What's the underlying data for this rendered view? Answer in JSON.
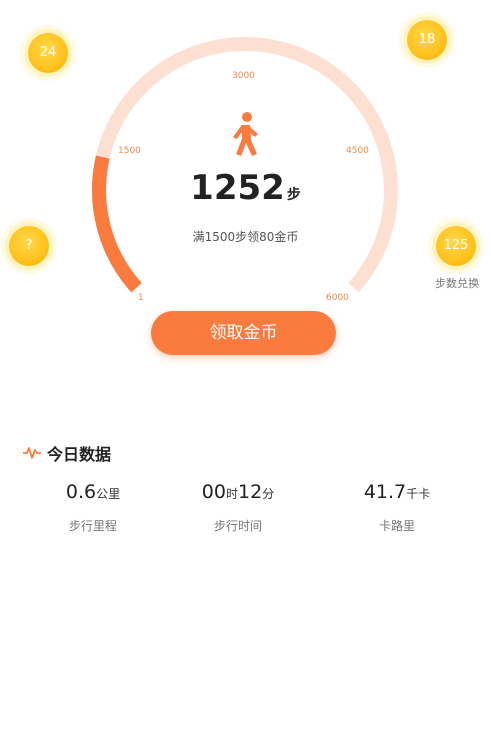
{
  "coins": {
    "top_left": "24",
    "top_right": "18",
    "mid_left": "?",
    "mid_right": "125",
    "mid_right_caption": "步数兑换"
  },
  "gauge": {
    "ticks": {
      "t3000": "3000",
      "t1500": "1500",
      "t4500": "4500",
      "t1": "1",
      "t6000": "6000"
    },
    "progress": {
      "current": 1252,
      "min": 1,
      "max": 6000
    },
    "steps": "1252",
    "steps_unit": "步",
    "hint": "满1500步领80金币",
    "colors": {
      "track": "#fde0d2",
      "fill": "#fb7b3f"
    }
  },
  "claim_button": {
    "label": "领取金币"
  },
  "today": {
    "title": "今日数据",
    "stats": [
      {
        "value": "0.6",
        "unit": "公里",
        "label": "步行里程"
      },
      {
        "value_h": "00",
        "unit_h": "时",
        "value_m": "12",
        "unit_m": "分",
        "label": "步行时间"
      },
      {
        "value": "41.7",
        "unit": "千卡",
        "label": "卡路里"
      }
    ]
  },
  "icons": {
    "walker": "walking-person-icon",
    "pulse": "heartbeat-pulse-icon"
  }
}
